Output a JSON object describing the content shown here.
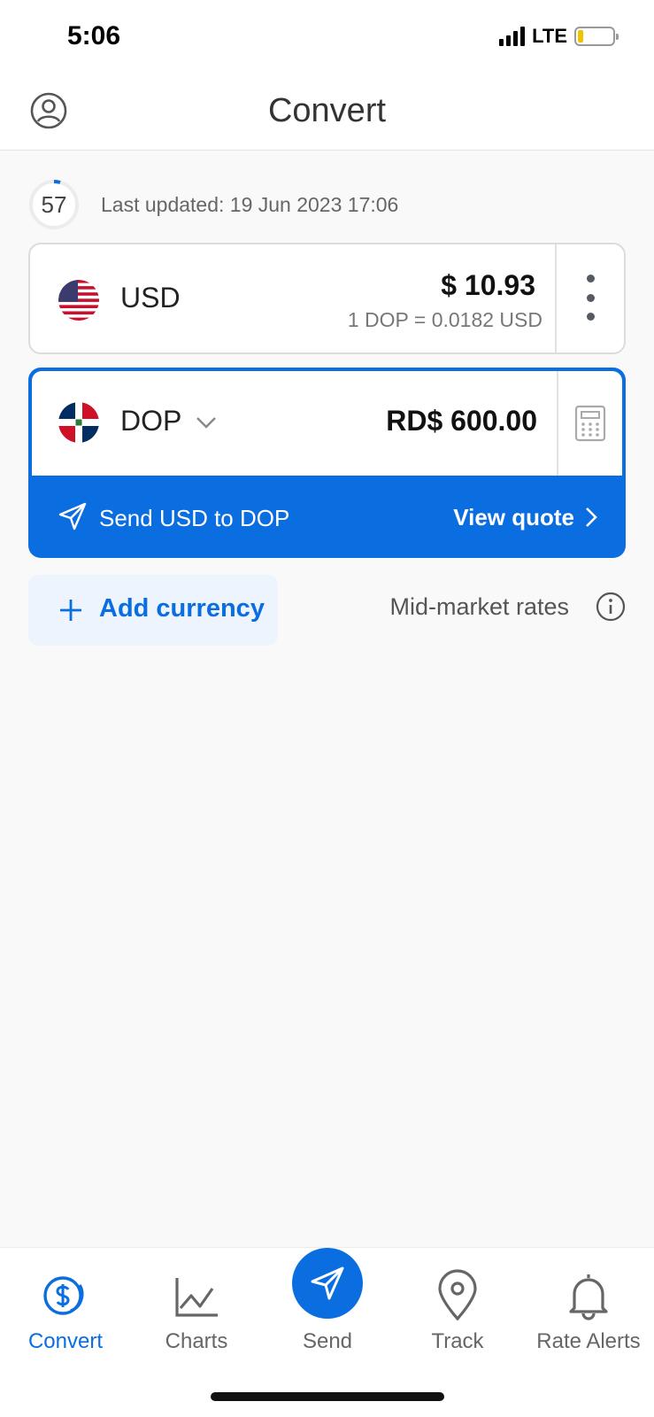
{
  "status_bar": {
    "time": "5:06",
    "network": "LTE"
  },
  "header": {
    "title": "Convert"
  },
  "timer": {
    "seconds": "57",
    "last_updated": "Last updated: 19 Jun 2023 17:06"
  },
  "base_currency": {
    "code": "USD",
    "amount": "$ 10.93",
    "rate": "1 DOP = 0.0182 USD",
    "flag_icon": "us-flag-icon"
  },
  "target_currency": {
    "code": "DOP",
    "amount": "RD$ 600.00",
    "flag_icon": "dominican-republic-flag-icon"
  },
  "send_row": {
    "label": "Send USD to DOP",
    "view_quote": "View quote"
  },
  "add_currency": {
    "label": "Add currency"
  },
  "mid_market": {
    "label": "Mid-market rates"
  },
  "bottom_nav": {
    "items": [
      {
        "label": "Convert",
        "icon": "dollar-coin-icon",
        "active": true
      },
      {
        "label": "Charts",
        "icon": "chart-line-icon"
      },
      {
        "label": "Send",
        "icon": "paper-plane-icon"
      },
      {
        "label": "Track",
        "icon": "location-pin-icon"
      },
      {
        "label": "Rate Alerts",
        "icon": "bell-icon"
      }
    ]
  },
  "colors": {
    "accent": "#0a6ee0",
    "background": "#f9f9f9"
  }
}
